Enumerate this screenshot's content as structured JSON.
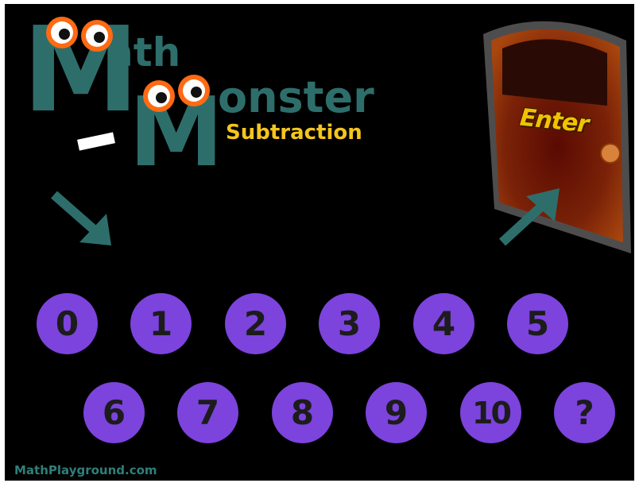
{
  "colors": {
    "background": "#000000",
    "logo_teal": "#2d6e6b",
    "subtitle_yellow": "#f4c51c",
    "button_purple": "#7c43dd",
    "button_text": "#1c1c1c",
    "door_brown": "#7a2208",
    "door_frame": "#4a4a4a",
    "enter_yellow": "#f2c200",
    "arrow_teal": "#2d6e6b",
    "footer_teal": "#2f7f7a"
  },
  "logo": {
    "word1_rest": "ath",
    "word2_rest": "onster",
    "dash": "-",
    "letter": "M",
    "subtitle": "Subtraction"
  },
  "door": {
    "label": "Enter"
  },
  "number_buttons": {
    "row1": [
      "0",
      "1",
      "2",
      "3",
      "4",
      "5"
    ],
    "row2": [
      "6",
      "7",
      "8",
      "9",
      "10",
      "?"
    ]
  },
  "icons": {
    "arrow_left": "arrow-down-right-icon",
    "arrow_right": "arrow-up-right-icon",
    "eyes": "monster-eyes-icon"
  },
  "footer": {
    "site": "MathPlayground.com"
  }
}
